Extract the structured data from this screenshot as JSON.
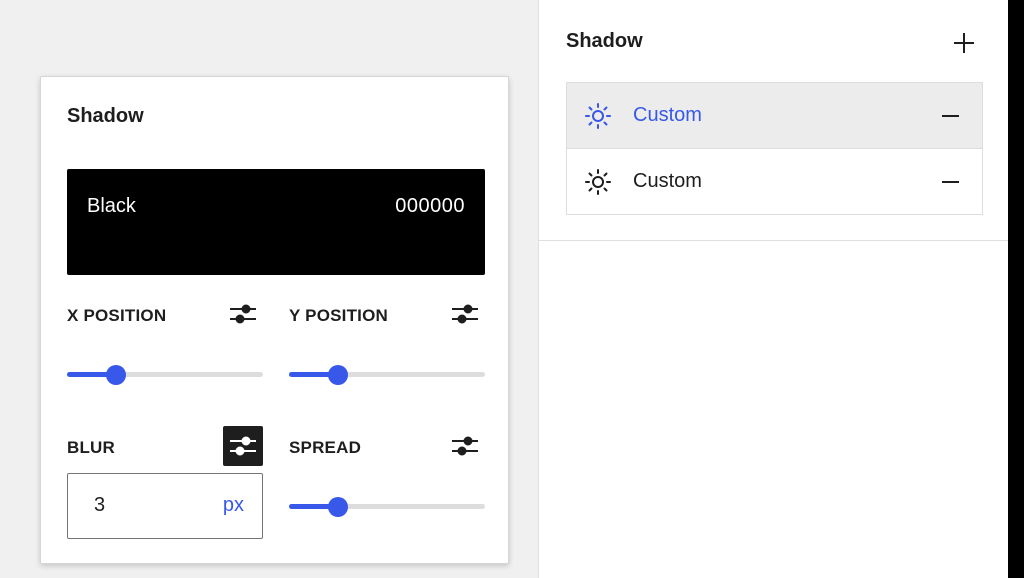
{
  "sidebar_panel": {
    "title": "Shadow",
    "add_icon": "plus-icon",
    "shadows": [
      {
        "label": "Custom",
        "icon": "sun-icon",
        "selected": true,
        "remove_icon": "minus-icon"
      },
      {
        "label": "Custom",
        "icon": "sun-icon",
        "selected": false,
        "remove_icon": "minus-icon"
      }
    ]
  },
  "popover": {
    "title": "Shadow",
    "color": {
      "name": "Black",
      "hex": "000000",
      "swatch": "#000000"
    },
    "controls": {
      "x_position": {
        "label": "X POSITION",
        "slider_fraction": 0.25,
        "toggle_icon": "sliders-icon",
        "toggle_active": false
      },
      "y_position": {
        "label": "Y POSITION",
        "slider_fraction": 0.25,
        "toggle_icon": "sliders-icon",
        "toggle_active": false
      },
      "blur": {
        "label": "BLUR",
        "value": "3",
        "unit": "px",
        "toggle_icon": "sliders-icon",
        "toggle_active": true
      },
      "spread": {
        "label": "SPREAD",
        "slider_fraction": 0.25,
        "toggle_icon": "sliders-icon",
        "toggle_active": false
      }
    }
  },
  "colors": {
    "accent": "#3858e9",
    "text": "#1e1e1e",
    "track": "#dddddd",
    "selected_row": "#ececec"
  }
}
